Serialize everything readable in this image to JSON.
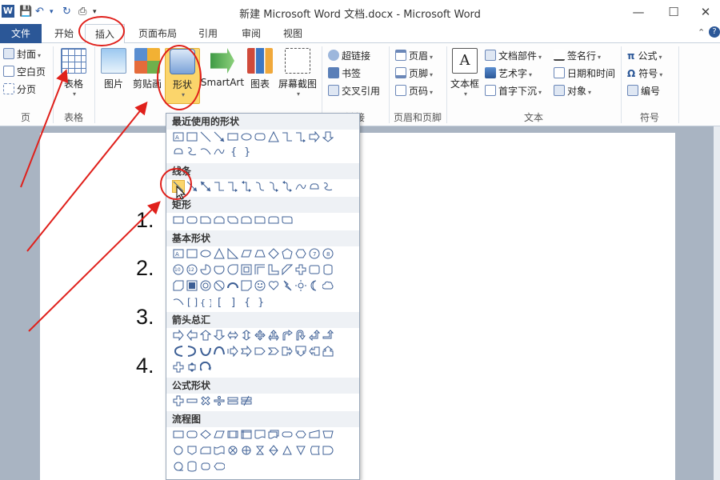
{
  "window": {
    "title": "新建 Microsoft Word 文档.docx - Microsoft Word",
    "controls": {
      "minimize": "—",
      "maximize": "☐",
      "close": "✕"
    }
  },
  "quick_access": {
    "save": "💾",
    "undo": "↶",
    "redo": "↻",
    "print": "⎙",
    "more": "▾"
  },
  "tabs": [
    {
      "label": "文件"
    },
    {
      "label": "开始"
    },
    {
      "label": "插入",
      "active": true
    },
    {
      "label": "页面布局"
    },
    {
      "label": "引用"
    },
    {
      "label": "审阅"
    },
    {
      "label": "视图"
    }
  ],
  "ribbon": {
    "page_group": {
      "label": "页",
      "items": [
        "封面",
        "空白页",
        "分页"
      ]
    },
    "table_group": {
      "label": "表格",
      "button": "表格"
    },
    "illustrations": {
      "picture": "图片",
      "clipart": "剪贴画",
      "shapes": "形状",
      "smartart": "SmartArt",
      "chart": "图表",
      "screenshot": "屏幕截图"
    },
    "links_group": {
      "label": "链接",
      "items": [
        "超链接",
        "书签",
        "交叉引用"
      ]
    },
    "header_footer_group": {
      "label": "页眉和页脚",
      "items": [
        "页眉",
        "页脚",
        "页码"
      ]
    },
    "text_group": {
      "label": "文本",
      "textbox": "文本框",
      "items": [
        "文档部件",
        "艺术字",
        "首字下沉",
        "签名行",
        "日期和时间",
        "对象"
      ]
    },
    "symbols_group": {
      "label": "符号",
      "items": [
        "公式",
        "符号",
        "编号"
      ]
    }
  },
  "document": {
    "list_numbers": [
      "1.",
      "2.",
      "3.",
      "4."
    ]
  },
  "shapes_menu": {
    "categories": [
      "最近使用的形状",
      "线条",
      "矩形",
      "基本形状",
      "箭头总汇",
      "公式形状",
      "流程图"
    ]
  },
  "colors": {
    "file_tab": "#2b5797",
    "annotation_red": "#e0201b",
    "hover_highlight": "#fbd56b"
  }
}
